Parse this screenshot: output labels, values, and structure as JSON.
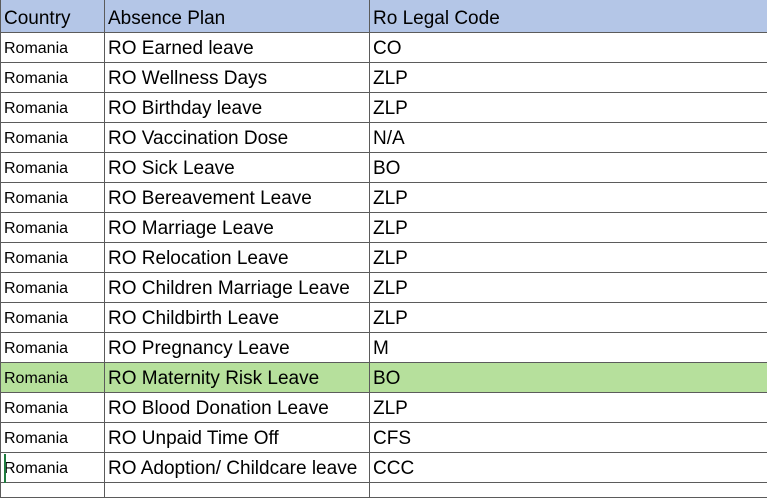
{
  "sheet": {
    "headers": {
      "country": "Country",
      "plan": "Absence Plan",
      "code": "Ro Legal Code"
    },
    "rows": [
      {
        "country": "Romania",
        "plan": "RO Earned leave",
        "code": "CO"
      },
      {
        "country": "Romania",
        "plan": "RO Wellness Days",
        "code": "ZLP"
      },
      {
        "country": "Romania",
        "plan": "RO Birthday leave",
        "code": "ZLP"
      },
      {
        "country": "Romania",
        "plan": "RO Vaccination Dose",
        "code": "N/A"
      },
      {
        "country": "Romania",
        "plan": "RO Sick Leave",
        "code": "BO"
      },
      {
        "country": "Romania",
        "plan": "RO Bereavement Leave",
        "code": "ZLP"
      },
      {
        "country": "Romania",
        "plan": "RO Marriage Leave",
        "code": "ZLP"
      },
      {
        "country": "Romania",
        "plan": "RO Relocation Leave",
        "code": "ZLP"
      },
      {
        "country": "Romania",
        "plan": "RO Children Marriage Leave",
        "code": "ZLP"
      },
      {
        "country": "Romania",
        "plan": "RO Childbirth Leave",
        "code": "ZLP"
      },
      {
        "country": "Romania",
        "plan": "RO Pregnancy Leave",
        "code": "M"
      },
      {
        "country": "Romania",
        "plan": "RO Maternity Risk Leave",
        "code": "BO"
      },
      {
        "country": "Romania",
        "plan": "RO Blood Donation Leave",
        "code": "ZLP"
      },
      {
        "country": "Romania",
        "plan": "RO Unpaid Time Off",
        "code": "CFS"
      },
      {
        "country": "Romania",
        "plan": "RO Adoption/ Childcare leave",
        "code": "CCC"
      }
    ],
    "highlight_color": "#b6e09c",
    "header_color": "#b4c6e7"
  }
}
